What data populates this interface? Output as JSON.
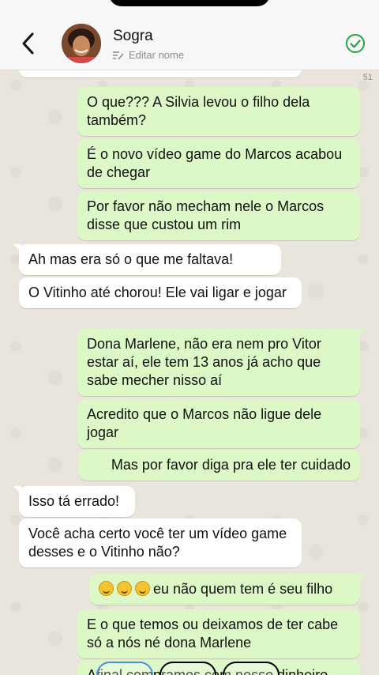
{
  "header": {
    "contact_name": "Sogra",
    "subtitle": "Editar nome"
  },
  "chat": {
    "message_count": "51",
    "messages": [
      {
        "from": "me",
        "text": "O que??? A Silvia levou o filho dela também?"
      },
      {
        "from": "me",
        "text": "É o novo vídeo game do Marcos acabou de chegar"
      },
      {
        "from": "me",
        "text": "Por favor não mecham nele o Marcos disse que custou um rim"
      },
      {
        "from": "them",
        "text": "Ah mas era só o que me faltava!"
      },
      {
        "from": "them",
        "text": "O Vitinho até chorou! Ele vai ligar e jogar"
      },
      {
        "from": "me",
        "text": "Dona Marlene, não era nem pro Vitor estar aí, ele tem 13 anos já acho que sabe mecher nisso aí"
      },
      {
        "from": "me",
        "text": "Acredito que o Marcos não ligue dele jogar"
      },
      {
        "from": "me",
        "text": "Mas por favor diga pra ele ter cuidado"
      },
      {
        "from": "them",
        "text": "Isso tá errado!"
      },
      {
        "from": "them",
        "text": "Você acha certo você ter um vídeo game desses e o Vitinho não?"
      },
      {
        "from": "me",
        "text": "eu não quem tem é seu filho"
      },
      {
        "from": "me",
        "text": "E o que temos ou deixamos de ter cabe só a nós né dona Marlene"
      },
      {
        "from": "me",
        "text": "Afinal compramos com nosso dinheiro"
      }
    ]
  },
  "icons": {
    "back": "chevron-left-icon",
    "edit": "edit-pencil-icon",
    "verified": "check-circle-icon",
    "emoji": "rolling-laughing-emoji"
  },
  "colors": {
    "outgoing_bubble": "#dcf8c6",
    "incoming_bubble": "#ffffff",
    "accent": "#25a244"
  }
}
